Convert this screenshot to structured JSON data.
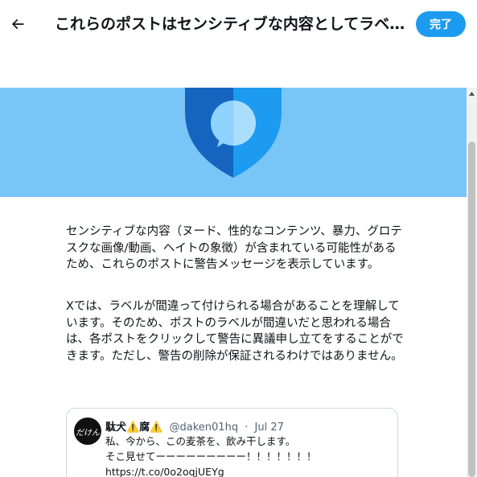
{
  "header": {
    "title": "これらのポストはセンシティブな内容としてラベル付けされています",
    "done_label": "完了"
  },
  "banner": {
    "color": "#78c6f7",
    "icon": "shield-message-icon"
  },
  "content": {
    "paragraph1": "センシティブな内容（ヌード、性的なコンテンツ、暴力、グロテスクな画像/動画、ヘイトの象徴）が含まれている可能性があるため、これらのポストに警告メッセージを表示しています。",
    "paragraph2": "Xでは、ラベルが間違って付けられる場合があることを理解しています。そのため、ポストのラベルが間違いだと思われる場合は、各ポストをクリックして警告に異議申し立てをすることができます。ただし、警告の削除が保証されるわけではありません。"
  },
  "tweet": {
    "avatar_text": "だけん",
    "name": "駄犬⚠️腐⚠️",
    "handle": "@daken01hq",
    "separator": "·",
    "date": "Jul 27",
    "line1": "私、今から、この麦茶を、飲み干します。",
    "line2": "そこ見せてーーーーーーーーー！！！！！！！",
    "link": "https://t.co/0o2oqjUEYg"
  },
  "colors": {
    "accent": "#1d9bf0",
    "border": "#cfd9de",
    "muted_text": "#536471"
  }
}
